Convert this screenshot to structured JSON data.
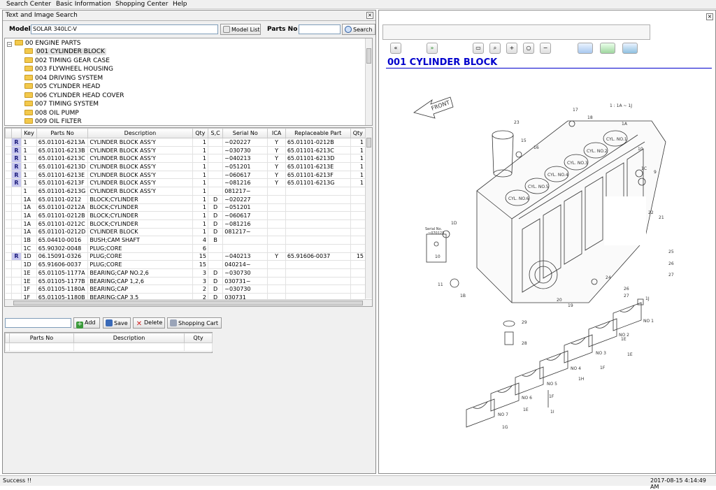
{
  "menu": [
    "Search Center",
    "Basic Information",
    "Shopping Center",
    "Help"
  ],
  "left_panel": {
    "title": "Text and Image Search",
    "model_label": "Model",
    "model_value": "SOLAR 340LC-V",
    "model_list_button": "Model List",
    "parts_no_label": "Parts No",
    "parts_no_value": "",
    "search_button": "Search",
    "tree_root": "00 ENGINE PARTS",
    "tree_items": [
      "001 CYLINDER BLOCK",
      "002 TIMING GEAR CASE",
      "003 FLYWHEEL HOUSING",
      "004 DRIVING SYSTEM",
      "005 CYLINDER HEAD",
      "006 CYLINDER HEAD COVER",
      "007 TIMING SYSTEM",
      "008 OIL PUMP",
      "009 OIL FILTER"
    ],
    "table_headers": [
      "Key",
      "Parts No",
      "Description",
      "Qty",
      "S,C",
      "Serial No",
      "ICA",
      "Replaceable Part",
      "Qty"
    ],
    "rows": [
      {
        "r": "R",
        "key": "1",
        "parts_no": "65.01101-6213A",
        "desc": "CYLINDER BLOCK ASS'Y",
        "qty": "1",
        "sc": "",
        "serial": "~020227",
        "ica": "Y",
        "repl": "65.01101-0212B",
        "rqty": "1"
      },
      {
        "r": "R",
        "key": "1",
        "parts_no": "65.01101-6213B",
        "desc": "CYLINDER BLOCK ASS'Y",
        "qty": "1",
        "sc": "",
        "serial": "~030730",
        "ica": "Y",
        "repl": "65.01101-6213C",
        "rqty": "1"
      },
      {
        "r": "R",
        "key": "1",
        "parts_no": "65.01101-6213C",
        "desc": "CYLINDER BLOCK ASS'Y",
        "qty": "1",
        "sc": "",
        "serial": "~040213",
        "ica": "Y",
        "repl": "65.01101-6213D",
        "rqty": "1"
      },
      {
        "r": "R",
        "key": "1",
        "parts_no": "65.01101-6213D",
        "desc": "CYLINDER BLOCK ASS'Y",
        "qty": "1",
        "sc": "",
        "serial": "~051201",
        "ica": "Y",
        "repl": "65.01101-6213E",
        "rqty": "1"
      },
      {
        "r": "R",
        "key": "1",
        "parts_no": "65.01101-6213E",
        "desc": "CYLINDER BLOCK ASS'Y",
        "qty": "1",
        "sc": "",
        "serial": "~060617",
        "ica": "Y",
        "repl": "65.01101-6213F",
        "rqty": "1"
      },
      {
        "r": "R",
        "key": "1",
        "parts_no": "65.01101-6213F",
        "desc": "CYLINDER BLOCK ASS'Y",
        "qty": "1",
        "sc": "",
        "serial": "~081216",
        "ica": "Y",
        "repl": "65.01101-6213G",
        "rqty": "1"
      },
      {
        "r": "",
        "key": "1",
        "parts_no": "65.01101-6213G",
        "desc": "CYLINDER BLOCK ASS'Y",
        "qty": "1",
        "sc": "",
        "serial": "081217~",
        "ica": "",
        "repl": "",
        "rqty": ""
      },
      {
        "r": "",
        "key": "1A",
        "parts_no": "65.01101-0212",
        "desc": "BLOCK;CYLINDER",
        "qty": "1",
        "sc": "D",
        "serial": "~020227",
        "ica": "",
        "repl": "",
        "rqty": ""
      },
      {
        "r": "",
        "key": "1A",
        "parts_no": "65.01101-0212A",
        "desc": "BLOCK;CYLINDER",
        "qty": "1",
        "sc": "D",
        "serial": "~051201",
        "ica": "",
        "repl": "",
        "rqty": ""
      },
      {
        "r": "",
        "key": "1A",
        "parts_no": "65.01101-0212B",
        "desc": "BLOCK;CYLINDER",
        "qty": "1",
        "sc": "D",
        "serial": "~060617",
        "ica": "",
        "repl": "",
        "rqty": ""
      },
      {
        "r": "",
        "key": "1A",
        "parts_no": "65.01101-0212C",
        "desc": "BLOCK;CYLINDER",
        "qty": "1",
        "sc": "D",
        "serial": "~081216",
        "ica": "",
        "repl": "",
        "rqty": ""
      },
      {
        "r": "",
        "key": "1A",
        "parts_no": "65.01101-0212D",
        "desc": "CYLINDER BLOCK",
        "qty": "1",
        "sc": "D",
        "serial": "081217~",
        "ica": "",
        "repl": "",
        "rqty": ""
      },
      {
        "r": "",
        "key": "1B",
        "parts_no": "65.04410-0016",
        "desc": "BUSH;CAM SHAFT",
        "qty": "4",
        "sc": "B",
        "serial": "",
        "ica": "",
        "repl": "",
        "rqty": ""
      },
      {
        "r": "",
        "key": "1C",
        "parts_no": "65.90302-0048",
        "desc": "PLUG;CORE",
        "qty": "6",
        "sc": "",
        "serial": "",
        "ica": "",
        "repl": "",
        "rqty": ""
      },
      {
        "r": "R",
        "key": "1D",
        "parts_no": "06.15091-0326",
        "desc": "PLUG;CORE",
        "qty": "15",
        "sc": "",
        "serial": "~040213",
        "ica": "Y",
        "repl": "65.91606-0037",
        "rqty": "15"
      },
      {
        "r": "",
        "key": "1D",
        "parts_no": "65.91606-0037",
        "desc": "PLUG;CORE",
        "qty": "15",
        "sc": "",
        "serial": "040214~",
        "ica": "",
        "repl": "",
        "rqty": ""
      },
      {
        "r": "",
        "key": "1E",
        "parts_no": "65.01105-1177A",
        "desc": "BEARING;CAP NO.2,6",
        "qty": "3",
        "sc": "D",
        "serial": "~030730",
        "ica": "",
        "repl": "",
        "rqty": ""
      },
      {
        "r": "",
        "key": "1E",
        "parts_no": "65.01105-1177B",
        "desc": "BEARING;CAP 1,2,6",
        "qty": "3",
        "sc": "D",
        "serial": "030731~",
        "ica": "",
        "repl": "",
        "rqty": ""
      },
      {
        "r": "",
        "key": "1F",
        "parts_no": "65.01105-1180A",
        "desc": "BEARING;CAP",
        "qty": "2",
        "sc": "D",
        "serial": "~030730",
        "ica": "",
        "repl": "",
        "rqty": ""
      },
      {
        "r": "",
        "key": "1F",
        "parts_no": "65.01105-1180B",
        "desc": "BEARING;CAP 3,5",
        "qty": "2",
        "sc": "D",
        "serial": "030731",
        "ica": "",
        "repl": "",
        "rqty": ""
      }
    ],
    "add_button": "Add",
    "save_button": "Save",
    "delete_button": "Delete",
    "shopping_cart_button": "Shopping Cart",
    "cart_headers": [
      "Parts No",
      "Description",
      "Qty"
    ]
  },
  "right_panel": {
    "drawing_title": "001 CYLINDER BLOCK",
    "diagram": {
      "front": "FRONT",
      "scale": "1 : 1A ~ 1J",
      "serial_note_1": "Serial No.",
      "serial_note_2": "~070123",
      "cylinders": [
        "CYL. NO.1",
        "CYL. NO.2",
        "CYL. NO.3",
        "CYL. NO.4",
        "CYL. NO.5",
        "CYL. NO.6"
      ],
      "caps": [
        "NO 1",
        "NO 2",
        "NO 3",
        "NO 4",
        "NO 5",
        "NO 6",
        "NO 7"
      ],
      "callouts": [
        "23",
        "15",
        "16",
        "17",
        "18",
        "1A",
        "10",
        "1C",
        "9",
        "22",
        "21",
        "1D",
        "10",
        "11",
        "1B",
        "20",
        "19",
        "24",
        "26",
        "27",
        "25",
        "26",
        "27",
        "1J",
        "29",
        "28",
        "1E",
        "1E",
        "1F",
        "1H",
        "1F",
        "1I",
        "1E",
        "1G"
      ]
    }
  },
  "status": {
    "message": "Success !!",
    "timestamp": "2017-08-15 4:14:49 AM"
  }
}
